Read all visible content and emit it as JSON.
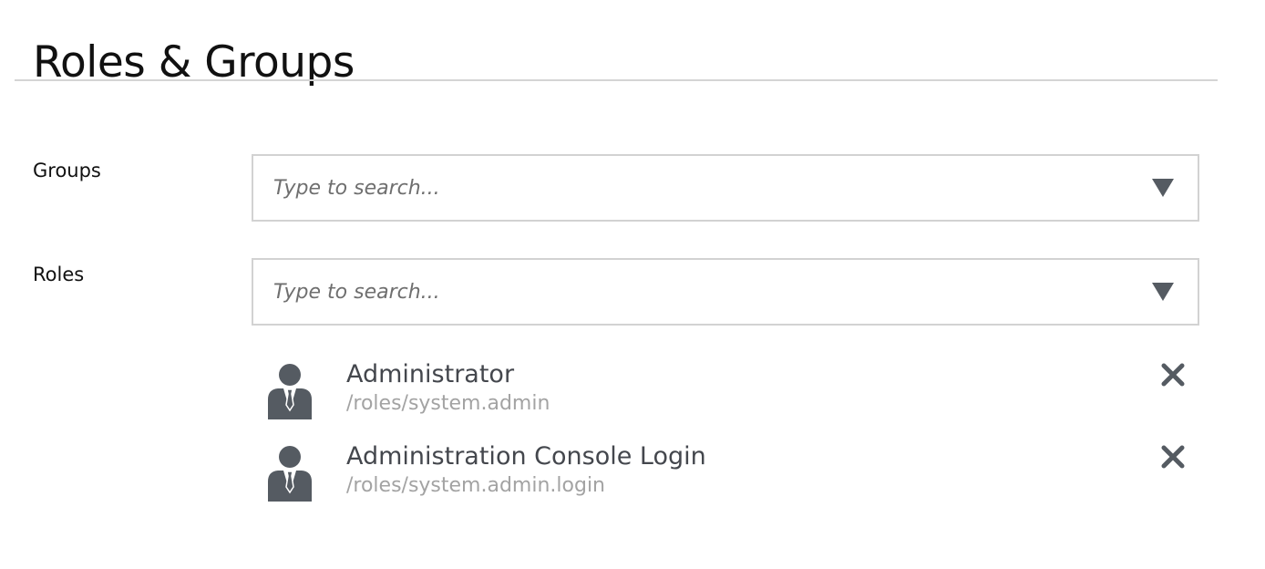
{
  "page": {
    "title": "Roles & Groups"
  },
  "groups": {
    "label": "Groups",
    "placeholder": "Type to search..."
  },
  "roles": {
    "label": "Roles",
    "placeholder": "Type to search...",
    "items": [
      {
        "name": "Administrator",
        "path": "/roles/system.admin",
        "icon": "user-suit-icon"
      },
      {
        "name": "Administration Console Login",
        "path": "/roles/system.admin.login",
        "icon": "user-suit-icon"
      }
    ]
  },
  "colors": {
    "icon": "#555b62",
    "path_text": "#a3a3a3",
    "name_text": "#44474d",
    "border": "#d2d2d2"
  }
}
